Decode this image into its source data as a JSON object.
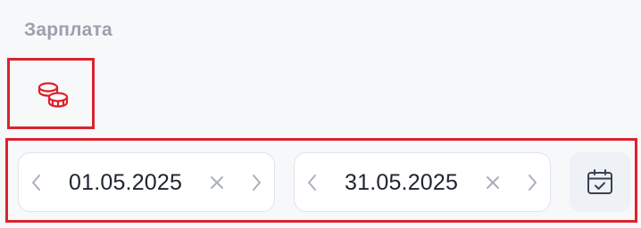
{
  "section": {
    "title": "Зарплата",
    "icon": "coins-icon",
    "accent_color": "#e0202a",
    "highlight_color": "#d9232d"
  },
  "date_range": {
    "from": {
      "value": "01.05.2025",
      "prev_icon": "chevron-left-icon",
      "next_icon": "chevron-right-icon",
      "clear_icon": "close-icon"
    },
    "to": {
      "value": "31.05.2025",
      "prev_icon": "chevron-left-icon",
      "next_icon": "chevron-right-icon",
      "clear_icon": "close-icon"
    },
    "calendar_icon": "calendar-check-icon"
  }
}
